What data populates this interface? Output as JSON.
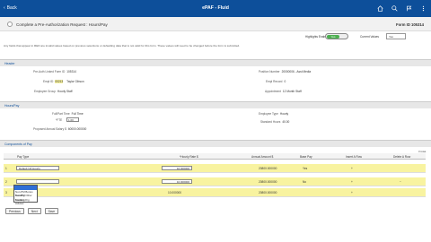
{
  "app": {
    "back_label": "Back",
    "title": "ePAF - Fluid"
  },
  "subheader": {
    "title": "Complete a Pre-Authorization Request : Hours/Pay",
    "form_id": "Form ID 105314"
  },
  "controls": {
    "highlights_label": "Highlights Enabled",
    "highlights_value": "Yes",
    "current_values_label": "Current Values",
    "current_values_value": "Yes"
  },
  "notice": "Any fields that appear in RED are invalid values based on previous selections or defaulting data that is not valid for this form. These values will need to be changed before the form is submitted.",
  "header_section": {
    "label": "Header",
    "pre_auth_label": "Pre-Auth Linked Form ID",
    "pre_auth_value": "105314",
    "emplid_label": "Empl ID",
    "emplid_value": "00213",
    "emp_name": "Taylor Gibson",
    "emp_group_label": "Employee Group",
    "emp_group_value": "Hourly Staff",
    "position_label": "Position Number",
    "position_value": "20000006 - Asst Media",
    "empl_record_label": "Empl Record",
    "empl_record_value": "0",
    "appointment_label": "Appointment",
    "appointment_value": "12 Month Staff"
  },
  "hours_section": {
    "label": "Hours/Pay",
    "full_part_label": "Full/Part Time",
    "full_part_value": "Full Time",
    "fte_label": "*FTE",
    "fte_value": "1.00",
    "proposed_salary_label": "Proposed Annual Salary $",
    "proposed_salary_value": "60000.000000",
    "employee_type_label": "Employee Type",
    "employee_type_value": "Hourly",
    "std_hours_label": "Standard Hours",
    "std_hours_value": "40.00"
  },
  "components": {
    "label": "Components of Pay",
    "rows_note": "3 rows",
    "columns": [
      "Pay Type",
      "*Hourly Rate $",
      "Annual Amount $",
      "Base Pay",
      "Insert A Row",
      "Delete A Row"
    ],
    "rows": [
      {
        "num": "1",
        "pay_type": "Default NA Hourly",
        "rate": "10.000000",
        "annual": "20800.000000",
        "base": "Yes"
      },
      {
        "num": "2",
        "pay_type": "",
        "rate": "10.000000",
        "annual": "20800.000000",
        "base": "No"
      },
      {
        "num": "3",
        "pay_type": "",
        "rate": "10.000000",
        "annual": "20800.000000",
        "base": ""
      }
    ],
    "dropdown_options": [
      "",
      "Non-PM Bonus Funding",
      "Non-PM Other Funding",
      "Student Org Advisor"
    ]
  },
  "buttons": {
    "previous": "Previous",
    "next": "Next",
    "save": "Save"
  },
  "colors": {
    "topbar": "#0d4f9a",
    "row_highlight": "#f8f3a0",
    "toggle_on": "#4caf50"
  }
}
